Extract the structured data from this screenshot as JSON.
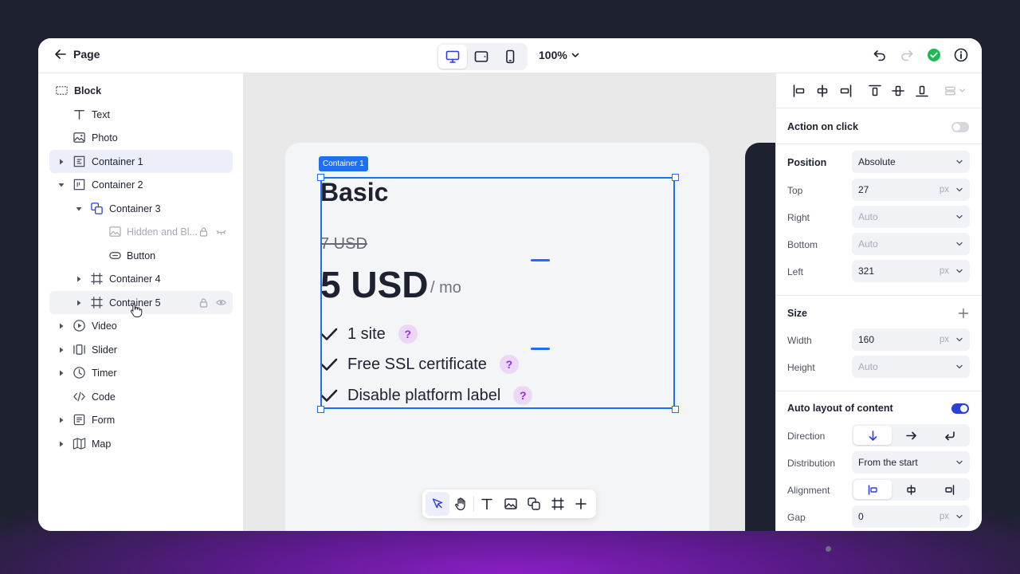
{
  "topbar": {
    "back_label": "Page",
    "zoom_value": "100%",
    "device_options": [
      "desktop",
      "tablet",
      "mobile"
    ],
    "active_device": "desktop"
  },
  "layers": {
    "items": [
      {
        "label": "Block",
        "icon": "block-icon"
      },
      {
        "label": "Text",
        "icon": "text-icon"
      },
      {
        "label": "Photo",
        "icon": "image-icon"
      },
      {
        "label": "Container 1",
        "icon": "frame-icon",
        "selected": true
      },
      {
        "label": "Container 2",
        "icon": "frame-icon",
        "expanded": true
      },
      {
        "label": "Container 3",
        "icon": "group-icon",
        "expanded": true
      },
      {
        "label": "Hidden and Bl...",
        "icon": "image-icon",
        "hidden": true,
        "locked": true
      },
      {
        "label": "Button",
        "icon": "button-icon"
      },
      {
        "label": "Container 4",
        "icon": "frame-icon"
      },
      {
        "label": "Container 5",
        "icon": "frame-icon",
        "hovered": true
      },
      {
        "label": "Video",
        "icon": "video-icon"
      },
      {
        "label": "Slider",
        "icon": "slider-icon"
      },
      {
        "label": "Timer",
        "icon": "timer-icon"
      },
      {
        "label": "Code",
        "icon": "code-icon"
      },
      {
        "label": "Form",
        "icon": "form-icon"
      },
      {
        "label": "Map",
        "icon": "map-icon"
      }
    ]
  },
  "canvas": {
    "selection_tag": "Container 1",
    "card": {
      "title": "Basic",
      "old_price": "7 USD",
      "price": "5 USD",
      "period": "/ mo",
      "features": [
        "1 site",
        "Free SSL certificate",
        "Disable platform label"
      ],
      "help_glyph": "?"
    },
    "tools": [
      "select-tool",
      "hand-tool",
      "text-tool",
      "image-tool",
      "group-tool",
      "frame-tool",
      "add-tool"
    ]
  },
  "inspector": {
    "action_on_click": {
      "label": "Action on click",
      "enabled": false
    },
    "position": {
      "label": "Position",
      "value": "Absolute",
      "top": {
        "label": "Top",
        "value": "27",
        "unit": "px"
      },
      "right": {
        "label": "Right",
        "value": "Auto"
      },
      "bottom": {
        "label": "Bottom",
        "value": "Auto"
      },
      "left": {
        "label": "Left",
        "value": "321",
        "unit": "px"
      }
    },
    "size": {
      "label": "Size",
      "width": {
        "label": "Width",
        "value": "160",
        "unit": "px"
      },
      "height": {
        "label": "Height",
        "value": "Auto"
      }
    },
    "auto_layout": {
      "label": "Auto layout of content",
      "enabled": true,
      "direction": {
        "label": "Direction",
        "active": "vertical"
      },
      "distribution": {
        "label": "Distribution",
        "value": "From the start"
      },
      "alignment": {
        "label": "Alignment",
        "active": "start"
      },
      "gap": {
        "label": "Gap",
        "value": "0",
        "unit": "px"
      }
    }
  },
  "colors": {
    "accent": "#2b3fd9",
    "selection": "#1f6ff5",
    "success": "#1db954",
    "help": "#9a2ad6"
  }
}
